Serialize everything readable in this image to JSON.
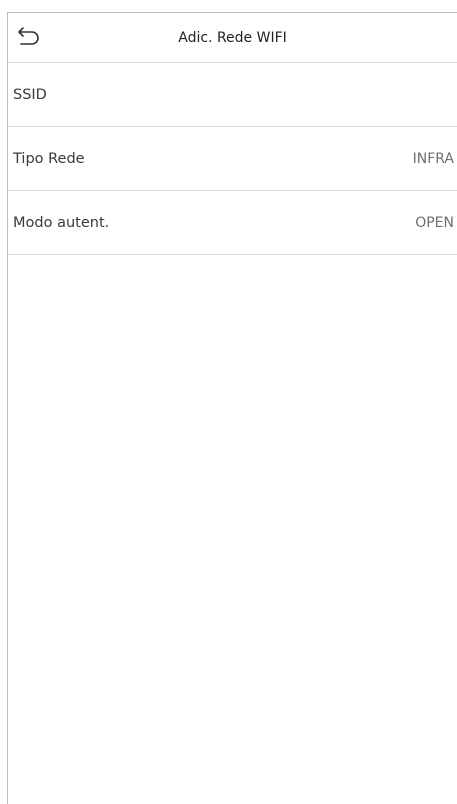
{
  "header": {
    "title": "Adic. Rede WIFI",
    "back_icon": "back-arrow-icon"
  },
  "settings": [
    {
      "label": "SSID",
      "value": ""
    },
    {
      "label": "Tipo Rede",
      "value": "INFRA"
    },
    {
      "label": "Modo autent.",
      "value": "OPEN"
    }
  ]
}
